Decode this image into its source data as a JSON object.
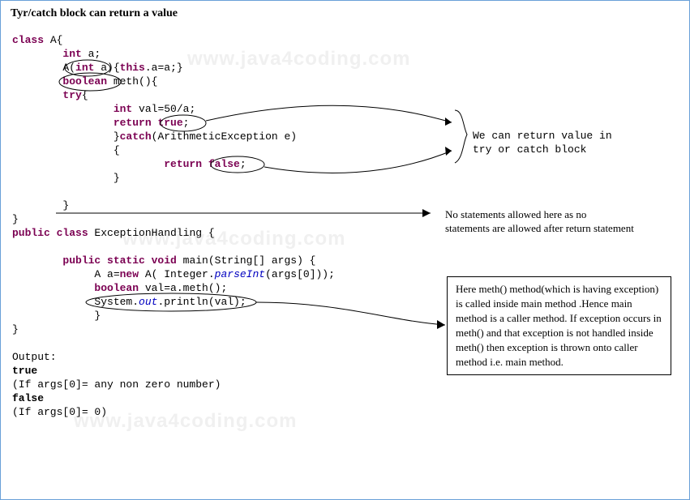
{
  "title": "Tyr/catch block can return a value",
  "code": {
    "l1a": "class",
    "l1b": " A{",
    "l2a": "        int",
    "l2b": " a;",
    "l3a": "        A(",
    "l3b": "int ",
    "l3c": "a){",
    "l3d": "this",
    "l3e": ".a=a;}",
    "l4a": "        boolean ",
    "l4b": "meth(){",
    "l5a": "        try",
    "l5b": "{",
    "l6a": "                int",
    "l6b": " val=50/a;",
    "l7a": "                return ",
    "l7b": "true",
    "l7c": ";",
    "l8a": "                }",
    "l8b": "catch",
    "l8c": "(ArithmeticException e)",
    "l9": "                {",
    "l10a": "                        return",
    "l10b": " false",
    "l10c": ";",
    "l11": "                }",
    "l12": "",
    "l13": "        }",
    "l14": "}",
    "l15a": "public class",
    "l15b": " ExceptionHandling {",
    "l16": "",
    "l17a": "        public static void",
    "l17b": " main(String[] args) {",
    "l18a": "             A a=",
    "l18b": "new ",
    "l18c": "A( Integer.",
    "l18d": "parseInt",
    "l18e": "(args[0]));",
    "l19a": "             boolean",
    "l19b": " val=a.meth();",
    "l20a": "             System.",
    "l20b": "out",
    "l20c": ".println(val);",
    "l21": "             }",
    "l22": "}",
    "l23": "",
    "l24": "Output:",
    "l25": "true",
    "l26": "(If args[0]= any non zero number)",
    "l27": "false",
    "l28": "(If args[0]= 0)"
  },
  "annot1": "We can return value in\ntry or catch block",
  "annot2": "No statements allowed here as no\nstatements are allowed after return statement",
  "annot3": "Here meth() method(which is having exception) is called inside main method .Hence main method is a caller method. If exception occurs in meth() and that exception is not handled  inside meth() then exception is thrown onto caller method i.e. main method.",
  "watermark": "www.java4coding.com"
}
